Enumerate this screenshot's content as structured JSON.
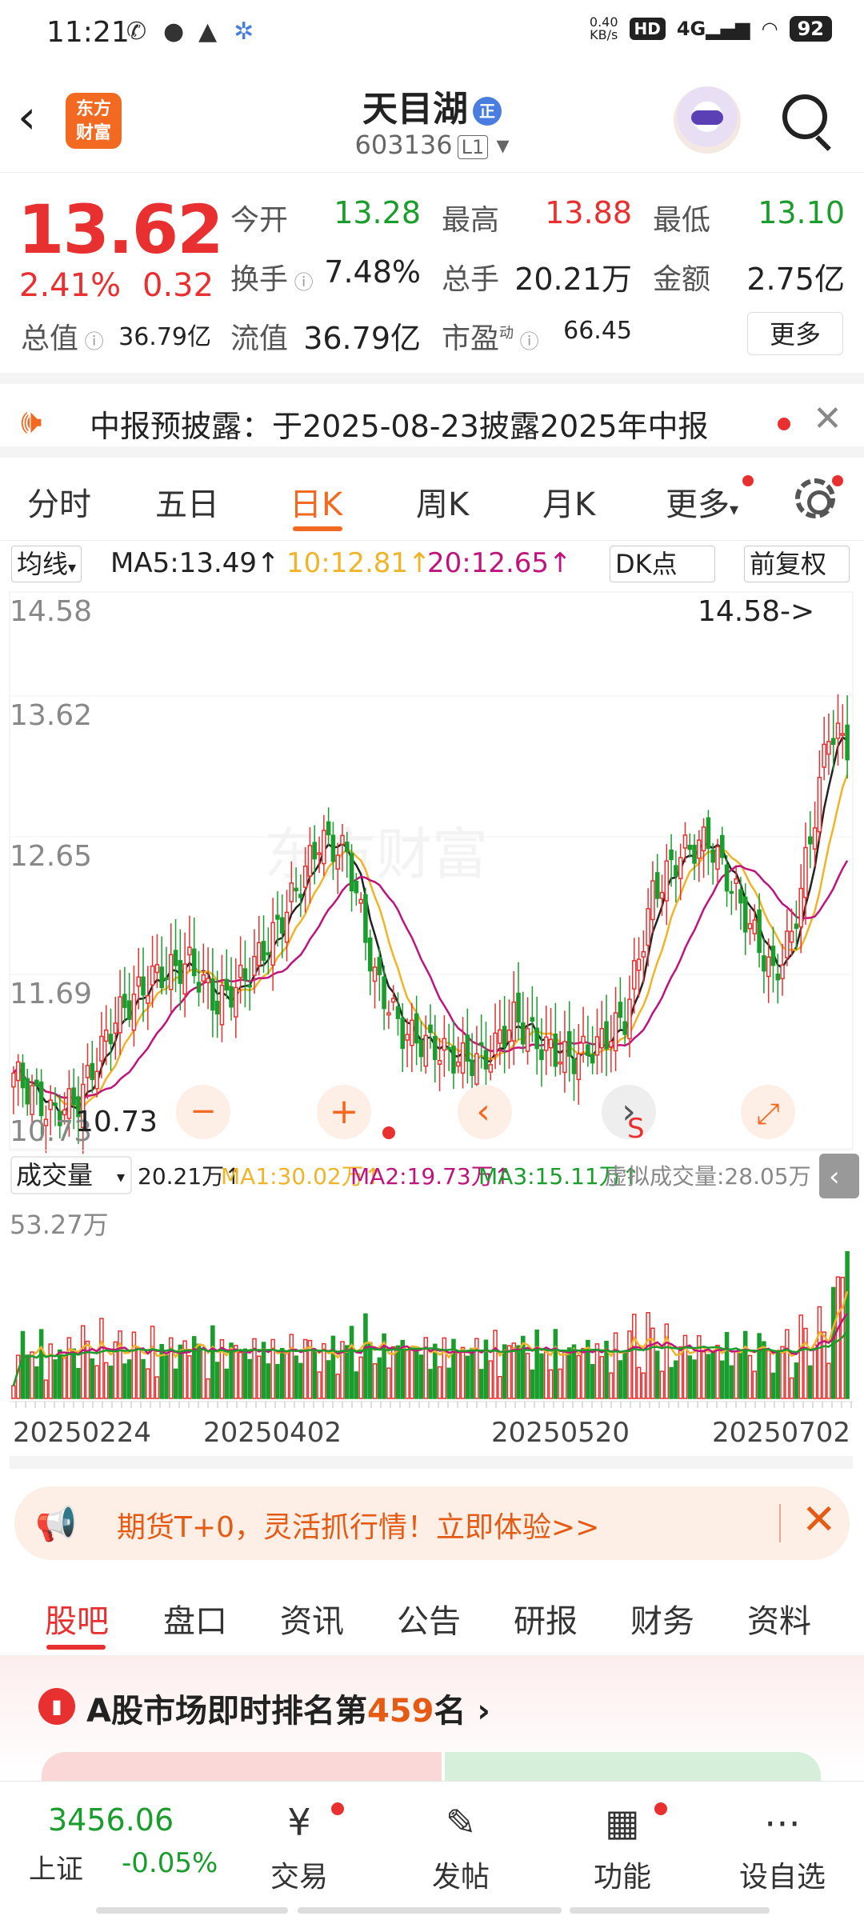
{
  "status": {
    "time": "11:21",
    "net_speed": "0.40",
    "net_unit": "KB/s",
    "hd": "HD",
    "signal": "4G",
    "battery": "92"
  },
  "header": {
    "stock_name": "天目湖",
    "badge": "正",
    "code": "603136",
    "level": "L1",
    "logo_text": "东方\n财富",
    "back": "‹"
  },
  "quote": {
    "price": "13.62",
    "change_pct": "2.41%",
    "change": "0.32",
    "fields": [
      {
        "label": "今开",
        "value": "13.28"
      },
      {
        "label": "最高",
        "value": "13.88"
      },
      {
        "label": "最低",
        "value": "13.10"
      },
      {
        "label": "换手",
        "value": "7.48%"
      },
      {
        "label": "总手",
        "value": "20.21万"
      },
      {
        "label": "金额",
        "value": "2.75亿"
      },
      {
        "label": "总值",
        "value": "36.79亿"
      },
      {
        "label": "流值",
        "value": "36.79亿"
      },
      {
        "label": "市盈",
        "sup": "动",
        "value": "66.45"
      }
    ],
    "more": "更多"
  },
  "notice": {
    "text": "中报预披露：于2025-08-23披露2025年中报",
    "close": "✕"
  },
  "tabs": [
    {
      "label": "分时"
    },
    {
      "label": "五日"
    },
    {
      "label": "日K"
    },
    {
      "label": "周K"
    },
    {
      "label": "月K"
    },
    {
      "label": "更多"
    }
  ],
  "active_tab": "日K",
  "ma": {
    "selector": "均线",
    "ma5": "MA5:13.49↑",
    "ma10": "10:12.81↑",
    "ma20": "20:12.65↑",
    "dk": "DK点",
    "adjust": "前复权"
  },
  "kline": {
    "y_labels": [
      "14.58",
      "13.62",
      "12.65",
      "11.69",
      "10.73"
    ],
    "high_mark": "14.58->",
    "low_mark": "10.73",
    "watermark": "东方财富",
    "controls": [
      "−",
      "+",
      "‹",
      "›",
      "⤢"
    ],
    "sell_mark": "S"
  },
  "volume": {
    "selector": "成交量",
    "vol": "20.21万↑",
    "ma1": "MA1:30.02万↑",
    "ma2": "MA2:19.73万↑",
    "ma3": "MA3:15.11万↑",
    "virtual": "虚拟成交量:28.05万",
    "max_label": "53.27万"
  },
  "dates": [
    "20250224",
    "20250402",
    "20250520",
    "20250702"
  ],
  "colors": {
    "up": "#e93030",
    "down": "#1a9d2c",
    "ma5": "#222222",
    "ma10": "#f0b429",
    "ma20": "#c0147d",
    "accent": "#f26a21"
  },
  "banner": {
    "text": "期货T+0，灵活抓行情！立即体验>>",
    "close": "✕"
  },
  "bottom_tabs": [
    {
      "label": "股吧"
    },
    {
      "label": "盘口"
    },
    {
      "label": "资讯"
    },
    {
      "label": "公告"
    },
    {
      "label": "研报"
    },
    {
      "label": "财务"
    },
    {
      "label": "资料"
    }
  ],
  "rank": {
    "prefix": "A股市场即时排名第",
    "number": "459",
    "suffix": "名 ›"
  },
  "bottom_nav": {
    "index_value": "3456.06",
    "index_name": "上证",
    "index_change": "-0.05%",
    "items": [
      {
        "label": "交易",
        "icon": "¥"
      },
      {
        "label": "发帖",
        "icon": "✎"
      },
      {
        "label": "功能",
        "icon": "▦"
      },
      {
        "label": "设自选",
        "icon": "⋯"
      }
    ]
  }
}
